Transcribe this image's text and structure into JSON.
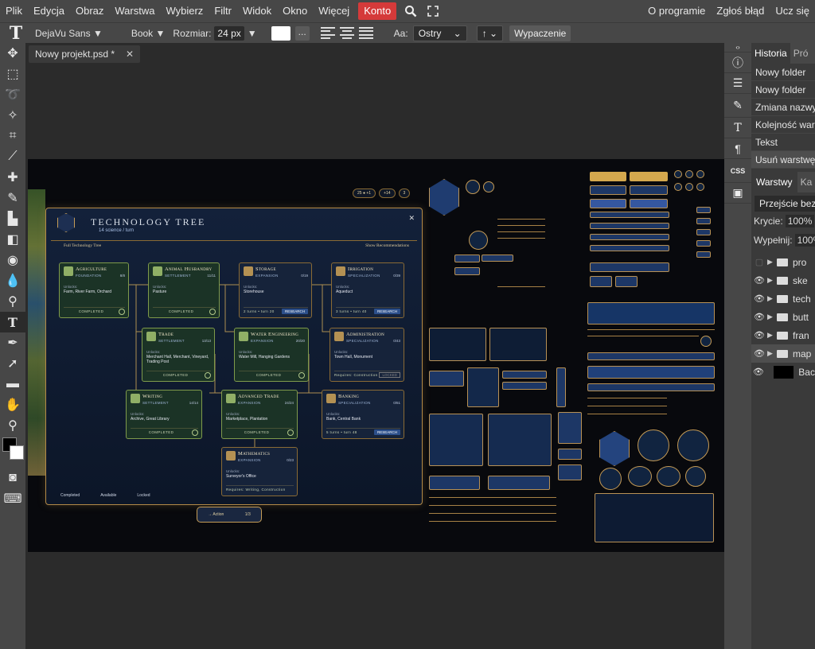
{
  "menu": {
    "items": [
      "Plik",
      "Edycja",
      "Obraz",
      "Warstwa",
      "Wybierz",
      "Filtr",
      "Widok",
      "Okno",
      "Więcej",
      "Konto"
    ],
    "right": [
      "O programie",
      "Zgłoś błąd",
      "Ucz się"
    ]
  },
  "options": {
    "font": "DejaVu Sans",
    "style": "Book",
    "size_label": "Rozmiar:",
    "size": "24 px",
    "dots": "...",
    "aa_label": "Aa:",
    "aa_value": "Ostry",
    "arrow": "↑",
    "fill_button": "Wypaczenie"
  },
  "document": {
    "tab": "Nowy projekt.psd *",
    "close": "✕"
  },
  "history": {
    "tabs": [
      "Historia",
      "Pró"
    ],
    "items": [
      "Nowy folder",
      "Nowy folder",
      "Zmiana nazwy",
      "Kolejność wars",
      "Tekst",
      "Usuń warstwę"
    ]
  },
  "layers": {
    "tabs": [
      "Warstwy",
      "Ka"
    ],
    "blend": "Przejście bezp",
    "opacity_label": "Krycie:",
    "opacity": "100%",
    "fill_label": "Wypełnij:",
    "fill": "100%",
    "items": [
      {
        "name": "pro",
        "visible": false
      },
      {
        "name": "ske",
        "visible": true
      },
      {
        "name": "tech",
        "visible": true
      },
      {
        "name": "butt",
        "visible": true
      },
      {
        "name": "fran",
        "visible": true
      },
      {
        "name": "map",
        "visible": true
      },
      {
        "name": "Bac",
        "visible": true
      }
    ]
  },
  "game": {
    "title": "Technology Tree",
    "science": "14 science / turn",
    "full_tree": "Full Technology Tree",
    "show_rec": "Show Recommendations",
    "top_stats": [
      "25 ● +1",
      "+14",
      "3"
    ],
    "close": "✕",
    "unlocks_label": "Unlocks:",
    "cards": [
      {
        "title": "Agriculture",
        "type": "Foundation",
        "count": "8/8",
        "unlocks": "Farm, River Farm, Orchard",
        "status": "Completed",
        "state": "done"
      },
      {
        "title": "Animal Husbandry",
        "type": "Settlement",
        "count": "11/11",
        "unlocks": "Pasture",
        "status": "Completed",
        "state": "done"
      },
      {
        "title": "Storage",
        "type": "Expansion",
        "count": "0/19",
        "unlocks": "Storehouse",
        "status": "2 turns • turn 20",
        "button": "Research",
        "state": "avail"
      },
      {
        "title": "Irrigation",
        "type": "Specialization",
        "count": "0/39",
        "unlocks": "Aqueduct",
        "status": "3 turns • turn 40",
        "button": "Research",
        "state": "avail"
      },
      {
        "title": "Trade",
        "type": "Settlement",
        "count": "13/13",
        "unlocks": "Merchant Hall, Merchant, Vineyard, Trading Post",
        "status": "Completed",
        "state": "done"
      },
      {
        "title": "Water Engineering",
        "type": "Expansion",
        "count": "20/20",
        "unlocks": "Water Mill, Hanging Gardens",
        "status": "Completed",
        "state": "done"
      },
      {
        "title": "Administration",
        "type": "Specialization",
        "count": "0/43",
        "unlocks": "Town Hall, Monument",
        "status": "Requires: Construction",
        "lock": "LOCKED",
        "state": "locked"
      },
      {
        "title": "Writing",
        "type": "Settlement",
        "count": "14/14",
        "unlocks": "Archive, Great Library",
        "status": "Completed",
        "state": "done"
      },
      {
        "title": "Advanced Trade",
        "type": "Expansion",
        "count": "24/24",
        "unlocks": "Marketplace, Plantation",
        "status": "Completed",
        "state": "done"
      },
      {
        "title": "Banking",
        "type": "Specialization",
        "count": "0/61",
        "unlocks": "Bank, Central Bank",
        "status": "5 turns • turn 48",
        "button": "Research",
        "state": "avail"
      },
      {
        "title": "Mathematics",
        "type": "Expansion",
        "count": "0/23",
        "unlocks": "Surveyor's Office",
        "status": "Requires: Writing, Construction",
        "state": "locked"
      }
    ],
    "legend": [
      "Completed",
      "Available",
      "Locked"
    ],
    "action_label": "→ Action",
    "action_count": "1/3"
  }
}
